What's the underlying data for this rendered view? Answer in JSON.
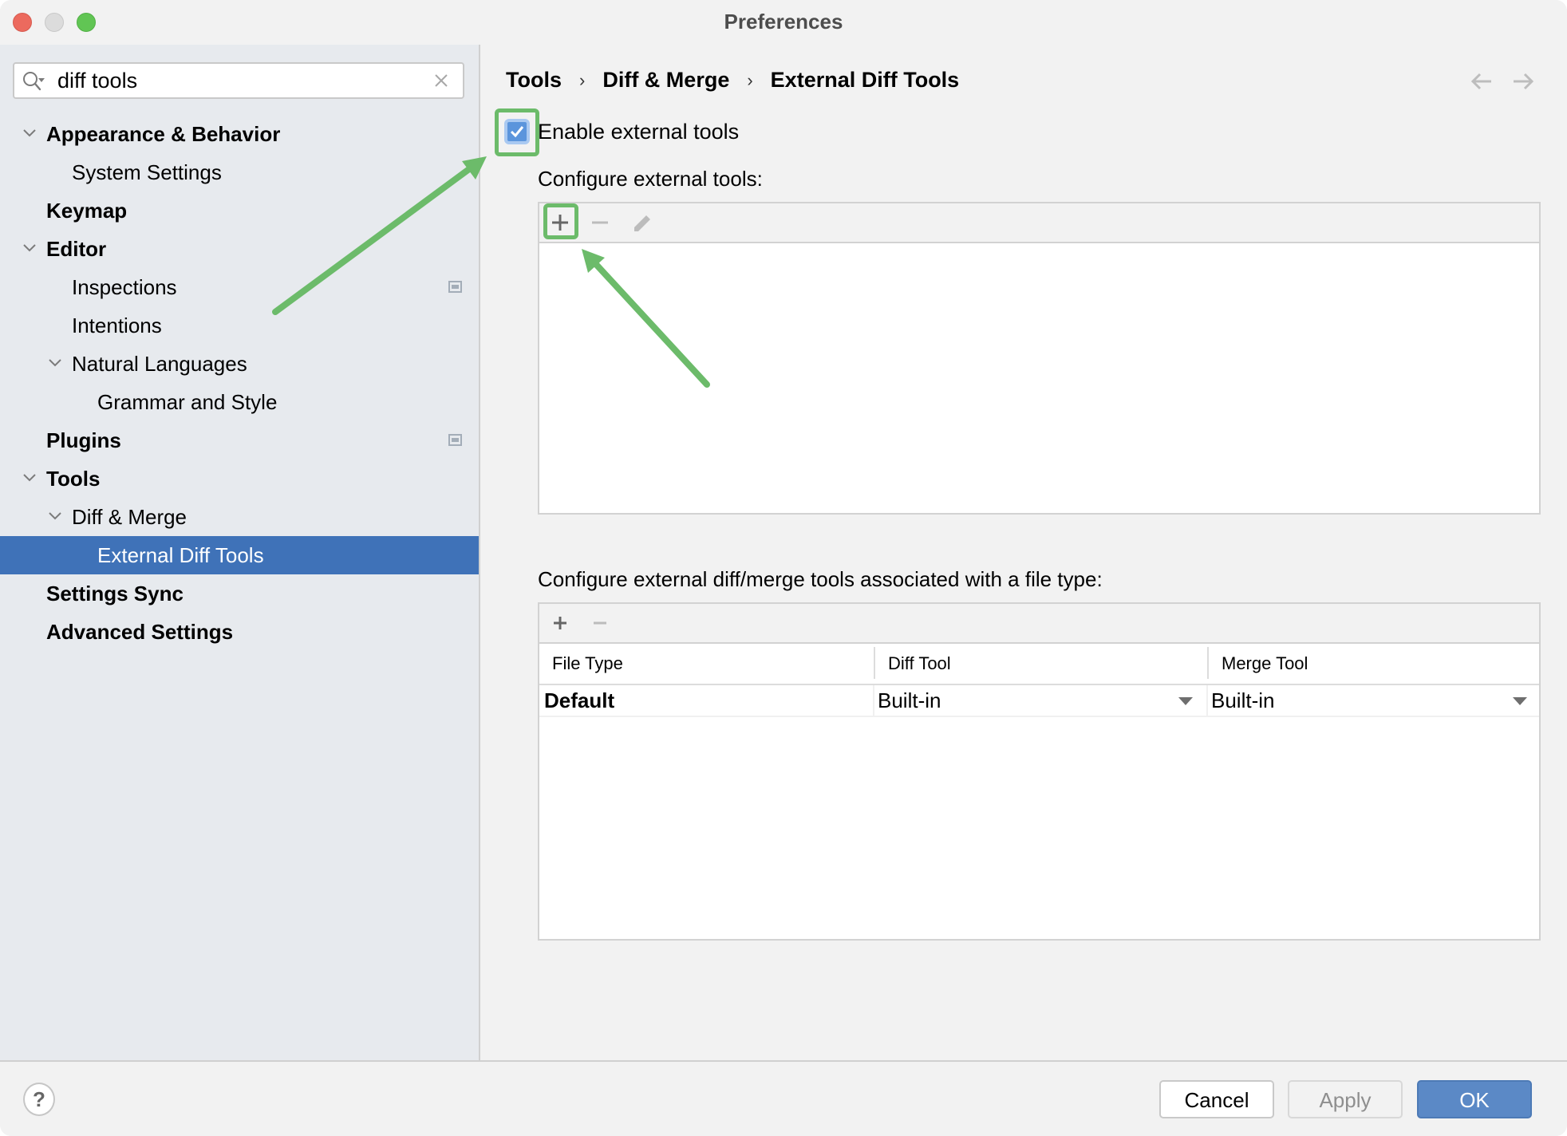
{
  "window": {
    "title": "Preferences",
    "traffic_lights": [
      "close",
      "minimize",
      "zoom"
    ]
  },
  "search": {
    "value": "diff tools",
    "placeholder": "",
    "icon": "search-icon",
    "clear_icon": "clear-icon"
  },
  "sidebar": {
    "items": [
      {
        "label": "Appearance & Behavior",
        "level": 0,
        "bold": true,
        "expanded": true
      },
      {
        "label": "System Settings",
        "level": 1,
        "bold": false
      },
      {
        "label": "Keymap",
        "level": 0,
        "bold": true
      },
      {
        "label": "Editor",
        "level": 0,
        "bold": true,
        "expanded": true
      },
      {
        "label": "Inspections",
        "level": 1,
        "bold": false,
        "badge": "project-settings-icon"
      },
      {
        "label": "Intentions",
        "level": 1,
        "bold": false
      },
      {
        "label": "Natural Languages",
        "level": 1,
        "bold": false,
        "expanded": true
      },
      {
        "label": "Grammar and Style",
        "level": 2,
        "bold": false
      },
      {
        "label": "Plugins",
        "level": 0,
        "bold": true,
        "badge": "project-settings-icon"
      },
      {
        "label": "Tools",
        "level": 0,
        "bold": true,
        "expanded": true
      },
      {
        "label": "Diff & Merge",
        "level": 1,
        "bold": false,
        "expanded": true
      },
      {
        "label": "External Diff Tools",
        "level": 2,
        "bold": false,
        "selected": true
      },
      {
        "label": "Settings Sync",
        "level": 0,
        "bold": true
      },
      {
        "label": "Advanced Settings",
        "level": 0,
        "bold": true
      }
    ]
  },
  "breadcrumb": [
    "Tools",
    "Diff & Merge",
    "External Diff Tools"
  ],
  "nav": {
    "back": "back-arrow-icon",
    "forward": "forward-arrow-icon"
  },
  "enable_external_tools": {
    "label": "Enable external tools",
    "checked": true
  },
  "external_tools": {
    "label": "Configure external tools:",
    "toolbar": {
      "add": "add-icon",
      "remove": "remove-icon",
      "edit": "edit-icon"
    },
    "items": []
  },
  "file_type_tools": {
    "label": "Configure external diff/merge tools associated with a file type:",
    "toolbar": {
      "add": "add-icon",
      "remove": "remove-icon"
    },
    "columns": [
      "File Type",
      "Diff Tool",
      "Merge Tool"
    ],
    "rows": [
      {
        "file_type": "Default",
        "diff_tool": "Built-in",
        "merge_tool": "Built-in"
      }
    ]
  },
  "footer": {
    "help": "?",
    "cancel": "Cancel",
    "apply": "Apply",
    "ok": "OK"
  },
  "annotations": {
    "highlight_color": "#6cbb6a",
    "accent": "#3f72b8"
  }
}
